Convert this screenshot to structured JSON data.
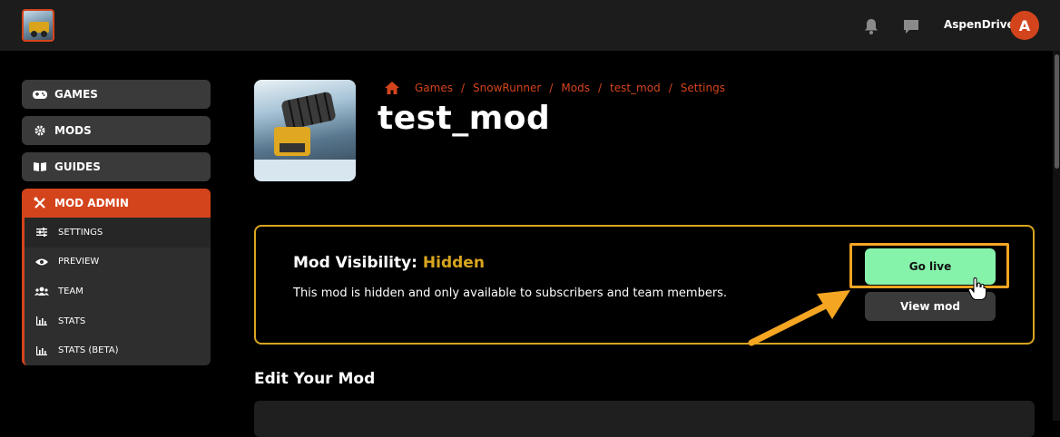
{
  "topbar": {
    "logo_icon": "snowrunner-game-logo",
    "notifications_icon": "bell-icon",
    "messages_icon": "chat-bubble-icon",
    "username": "AspenDriver",
    "avatar_letter": "A",
    "avatar_color": "#d4441c"
  },
  "sidebar": {
    "items": [
      {
        "label": "GAMES",
        "icon": "gamepad-icon"
      },
      {
        "label": "MODS",
        "icon": "gear-icon"
      },
      {
        "label": "GUIDES",
        "icon": "book-icon"
      }
    ],
    "admin": {
      "label": "MOD ADMIN",
      "icon": "tools-icon",
      "accent": "#d4441c",
      "items": [
        {
          "label": "SETTINGS",
          "icon": "sliders-icon",
          "active": true
        },
        {
          "label": "PREVIEW",
          "icon": "eye-icon",
          "active": false
        },
        {
          "label": "TEAM",
          "icon": "users-icon",
          "active": false
        },
        {
          "label": "STATS",
          "icon": "bar-chart-icon",
          "active": false
        },
        {
          "label": "STATS (BETA)",
          "icon": "bar-chart-icon",
          "active": false
        }
      ]
    }
  },
  "header": {
    "breadcrumb": {
      "home_icon": "home-icon",
      "items": [
        "Games",
        "SnowRunner",
        "Mods",
        "test_mod",
        "Settings"
      ],
      "separator": "/"
    },
    "title": "test_mod"
  },
  "visibility": {
    "label": "Mod Visibility:",
    "status": "Hidden",
    "status_color": "#d9a520",
    "description": "This mod is hidden and only available to subscribers and team members.",
    "go_live_label": "Go live",
    "go_live_color": "#86f3ab",
    "view_mod_label": "View mod",
    "highlight_color": "#f4a522"
  },
  "edit": {
    "title": "Edit Your Mod"
  }
}
